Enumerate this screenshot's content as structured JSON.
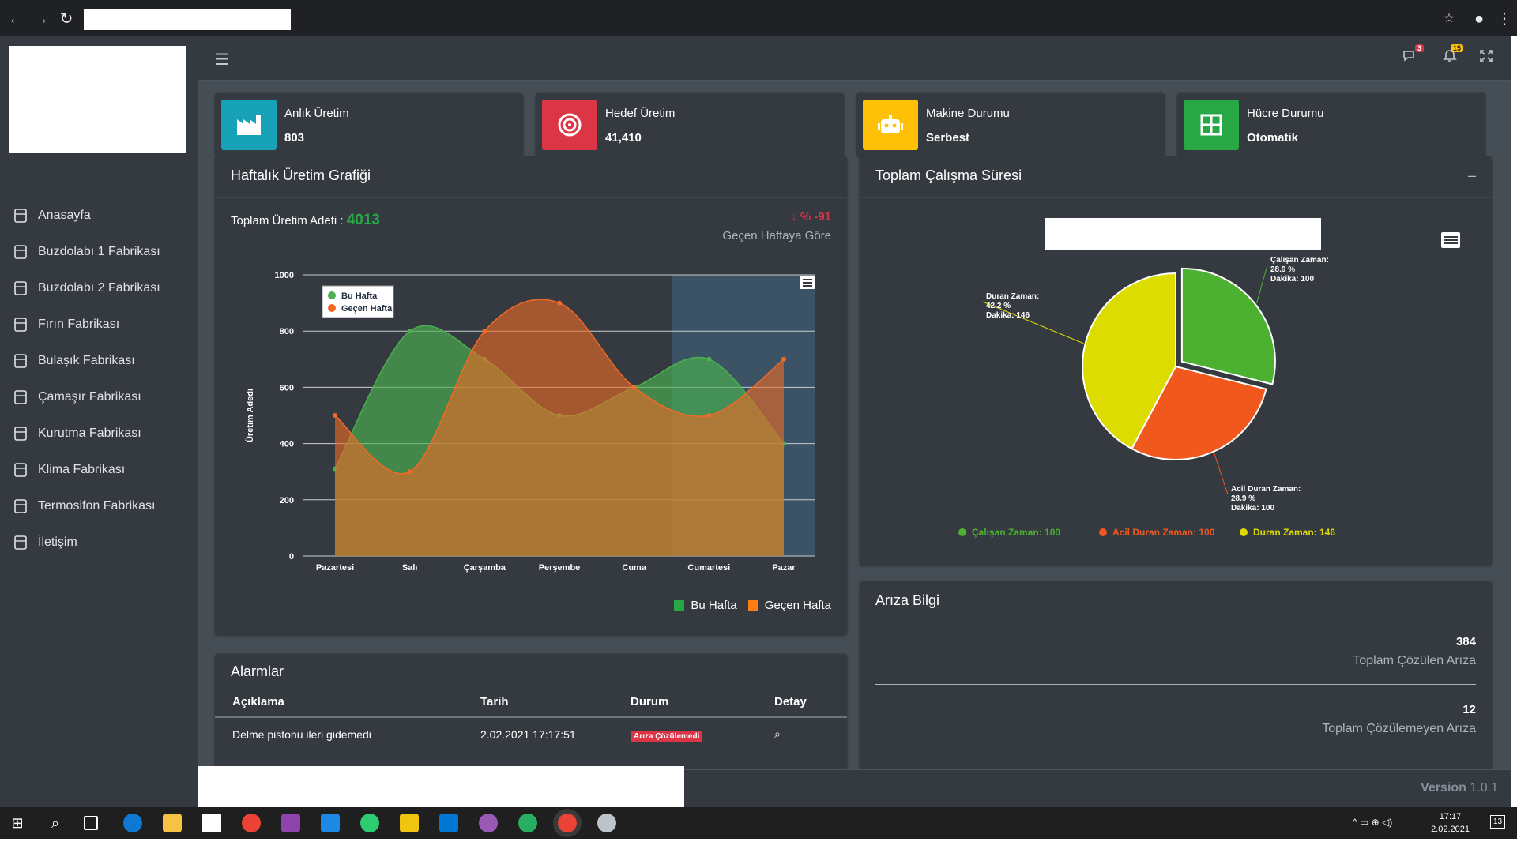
{
  "sidebar": {
    "items": [
      {
        "label": "Anasayfa",
        "icon": "home-icon"
      },
      {
        "label": "Buzdolabı 1 Fabrikası",
        "icon": "fridge-icon"
      },
      {
        "label": "Buzdolabı 2 Fabrikası",
        "icon": "fridge-icon"
      },
      {
        "label": "Fırın Fabrikası",
        "icon": "oven-icon"
      },
      {
        "label": "Bulaşık Fabrikası",
        "icon": "dishwasher-icon"
      },
      {
        "label": "Çamaşır Fabrikası",
        "icon": "washer-icon"
      },
      {
        "label": "Kurutma Fabrikası",
        "icon": "dryer-icon"
      },
      {
        "label": "Klima Fabrikası",
        "icon": "aircon-icon"
      },
      {
        "label": "Termosifon Fabrikası",
        "icon": "heater-icon"
      },
      {
        "label": "İletişim",
        "icon": "mail-icon"
      }
    ]
  },
  "topbar": {
    "messages_count": "3",
    "notifications_count": "15"
  },
  "info_boxes": [
    {
      "label": "Anlık Üretim",
      "value": "803",
      "color": "#17a2b8",
      "icon": "factory-icon"
    },
    {
      "label": "Hedef Üretim",
      "value": "41,410",
      "color": "#dc3545",
      "icon": "target-icon"
    },
    {
      "label": "Makine Durumu",
      "value": "Serbest",
      "color": "#ffc107",
      "icon": "robot-icon"
    },
    {
      "label": "Hücre Durumu",
      "value": "Otomatik",
      "color": "#28a745",
      "icon": "grid-icon"
    }
  ],
  "weekly": {
    "title": "Haftalık Üretim Grafiği",
    "total_label": "Toplam Üretim Adeti :",
    "total_value": "4013",
    "change": "% -91",
    "change_caption": "Geçen Haftaya Göre",
    "legend_bottom": [
      "Bu Hafta",
      "Geçen Hafta"
    ]
  },
  "pie_card": {
    "title": "Toplam Çalışma Süresi",
    "collapse": "–"
  },
  "ariza": {
    "title": "Arıza Bilgi",
    "solved_value": "384",
    "solved_label": "Toplam Çözülen Arıza",
    "unsolved_value": "12",
    "unsolved_label": "Toplam Çözülemeyen Arıza"
  },
  "alarms": {
    "title": "Alarmlar",
    "headers": [
      "Açıklama",
      "Tarih",
      "Durum",
      "Detay"
    ],
    "rows": [
      {
        "desc": "Delme pistonu ileri gidemedi",
        "date": "2.02.2021 17:17:51",
        "status": "Arıza Çözülemedi"
      }
    ]
  },
  "footer": {
    "version_label": "Version",
    "version_value": "1.0.1"
  },
  "taskbar": {
    "time": "17:17",
    "date": "2.02.2021",
    "notif": "13"
  },
  "chart_data": [
    {
      "type": "area",
      "categories": [
        "Pazartesi",
        "Salı",
        "Çarşamba",
        "Perşembe",
        "Cuma",
        "Cumartesi",
        "Pazar"
      ],
      "series": [
        {
          "name": "Bu Hafta",
          "values": [
            310,
            800,
            700,
            500,
            600,
            700,
            400
          ],
          "color": "#4cb050"
        },
        {
          "name": "Geçen Hafta",
          "values": [
            500,
            300,
            800,
            900,
            600,
            500,
            700
          ],
          "color": "#f26a25"
        }
      ],
      "ylabel": "Üretim Adedi",
      "ylim": [
        0,
        1000
      ],
      "yticks": [
        0,
        200,
        400,
        600,
        800,
        1000
      ],
      "legend": "top-left",
      "grid": true
    },
    {
      "type": "pie",
      "labels": [
        "Çalışan Zaman",
        "Acil Duran Zaman",
        "Duran Zaman"
      ],
      "values": [
        100,
        100,
        146
      ],
      "percent": [
        "28.9 %",
        "28.9 %",
        "42.2 %"
      ],
      "colors": [
        "#4cb030",
        "#f0581e",
        "#dcdc00"
      ],
      "callouts": [
        [
          "Çalışan Zaman:",
          "28.9 %",
          "Dakika: 100"
        ],
        [
          "Acil Duran Zaman:",
          "28.9 %",
          "Dakika: 100"
        ],
        [
          "Duran Zaman:",
          "42.2 %",
          "Dakika: 146"
        ]
      ],
      "legend_entries": [
        "Çalışan Zaman: 100",
        "Acil Duran Zaman: 100",
        "Duran Zaman: 146"
      ]
    }
  ]
}
